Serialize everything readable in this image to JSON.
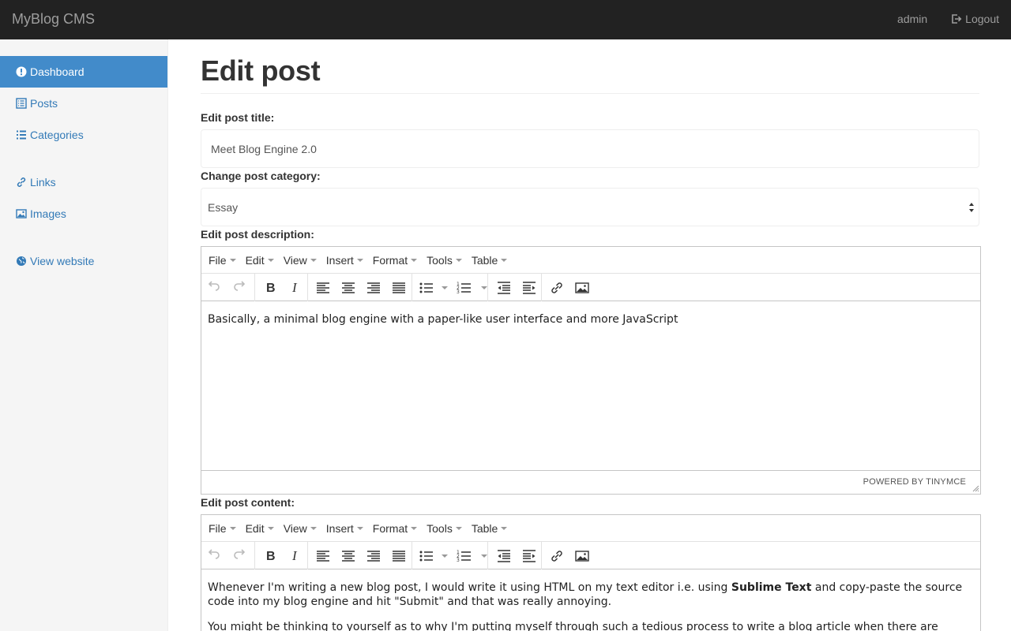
{
  "navbar": {
    "brand": "MyBlog CMS",
    "user": "admin",
    "logout": "Logout"
  },
  "sidebar": {
    "items": [
      {
        "label": "Dashboard",
        "icon": "exclamation-circle-icon",
        "active": true
      },
      {
        "label": "Posts",
        "icon": "list-alt-icon"
      },
      {
        "label": "Categories",
        "icon": "list-icon"
      },
      {
        "label": "Links",
        "icon": "link-icon"
      },
      {
        "label": "Images",
        "icon": "picture-icon"
      },
      {
        "label": "View website",
        "icon": "globe-icon"
      }
    ]
  },
  "main": {
    "title": "Edit post",
    "title_label": "Edit post title:",
    "title_value": "Meet Blog Engine 2.0",
    "category_label": "Change post category:",
    "category_value": "Essay",
    "description_label": "Edit post description:",
    "content_label": "Edit post content:"
  },
  "editor": {
    "menu": [
      "File",
      "Edit",
      "View",
      "Insert",
      "Format",
      "Tools",
      "Table"
    ],
    "powered_by": "POWERED BY TINYMCE",
    "toolbar_icons": [
      "undo-icon",
      "redo-icon",
      "bold-icon",
      "italic-icon",
      "align-left-icon",
      "align-center-icon",
      "align-right-icon",
      "align-justify-icon",
      "bullet-list-icon",
      "numbered-list-icon",
      "outdent-icon",
      "indent-icon",
      "link-icon",
      "image-icon"
    ]
  },
  "description_editor": {
    "text": "Basically, a minimal blog engine with a paper-like user interface and more JavaScript"
  },
  "content_editor": {
    "p1_before": "Whenever I'm writing a new blog post, I would write it using HTML on my text editor i.e. using ",
    "p1_bold": "Sublime Text",
    "p1_after": " and copy-paste the source code into my blog engine and hit \"Submit\" and that was really annoying.",
    "p2": "You might be thinking to yourself as to why I'm putting myself through such a tedious process to write a blog article when there are"
  },
  "colors": {
    "navbar_bg": "#222222",
    "active_bg": "#428bca",
    "link": "#337ab7"
  }
}
